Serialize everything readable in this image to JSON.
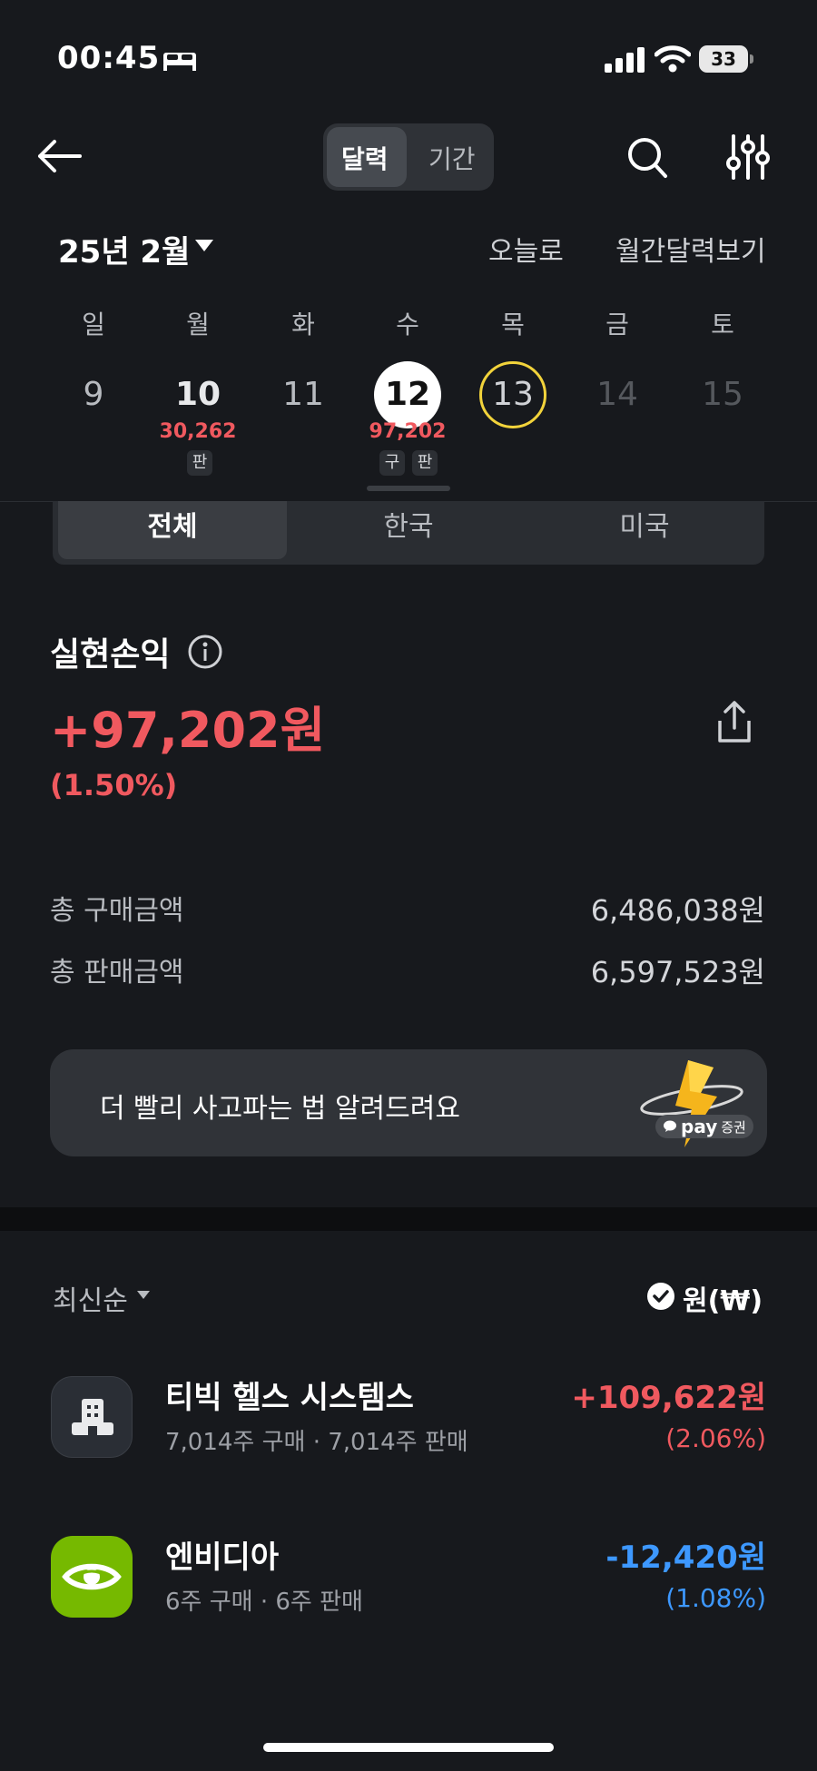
{
  "status_bar": {
    "time": "00:45",
    "battery": "33"
  },
  "header": {
    "seg_calendar": "달력",
    "seg_period": "기간"
  },
  "month_row": {
    "month": "25년 2월",
    "today_link": "오늘로",
    "monthly_link": "월간달력보기"
  },
  "calendar": {
    "weekdays": [
      "일",
      "월",
      "화",
      "수",
      "목",
      "금",
      "토"
    ],
    "days": [
      "9",
      "10",
      "11",
      "12",
      "13",
      "14",
      "15"
    ],
    "mon_pnl": "30,262",
    "mon_chip": "판",
    "wed_pnl": "97,202",
    "wed_chip_buy": "구",
    "wed_chip_sell": "판"
  },
  "region_tabs": [
    "전체",
    "한국",
    "미국"
  ],
  "realized": {
    "title": "실현손익",
    "amount": "+97,202원",
    "percent": "(1.50%)"
  },
  "stats": {
    "buy_label": "총 구매금액",
    "buy_value": "6,486,038원",
    "sell_label": "총 판매금액",
    "sell_value": "6,597,523원"
  },
  "banner": {
    "text": "더 빨리 사고파는 법 알려드려요",
    "badge_pay": "pay",
    "badge_kr": "증권"
  },
  "sort": {
    "label": "최신순",
    "currency": "원(₩)"
  },
  "items": [
    {
      "name": "티빅 헬스 시스템스",
      "sub": "7,014주 구매 · 7,014주 판매",
      "amount": "+109,622원",
      "pct": "(2.06%)"
    },
    {
      "name": "엔비디아",
      "sub": "6주 구매 · 6주 판매",
      "amount": "-12,420원",
      "pct": "(1.08%)"
    }
  ],
  "colors": {
    "up": "#f0595f",
    "down": "#3d98ff",
    "today_ring": "#f2d33b",
    "nvidia": "#76b900"
  }
}
